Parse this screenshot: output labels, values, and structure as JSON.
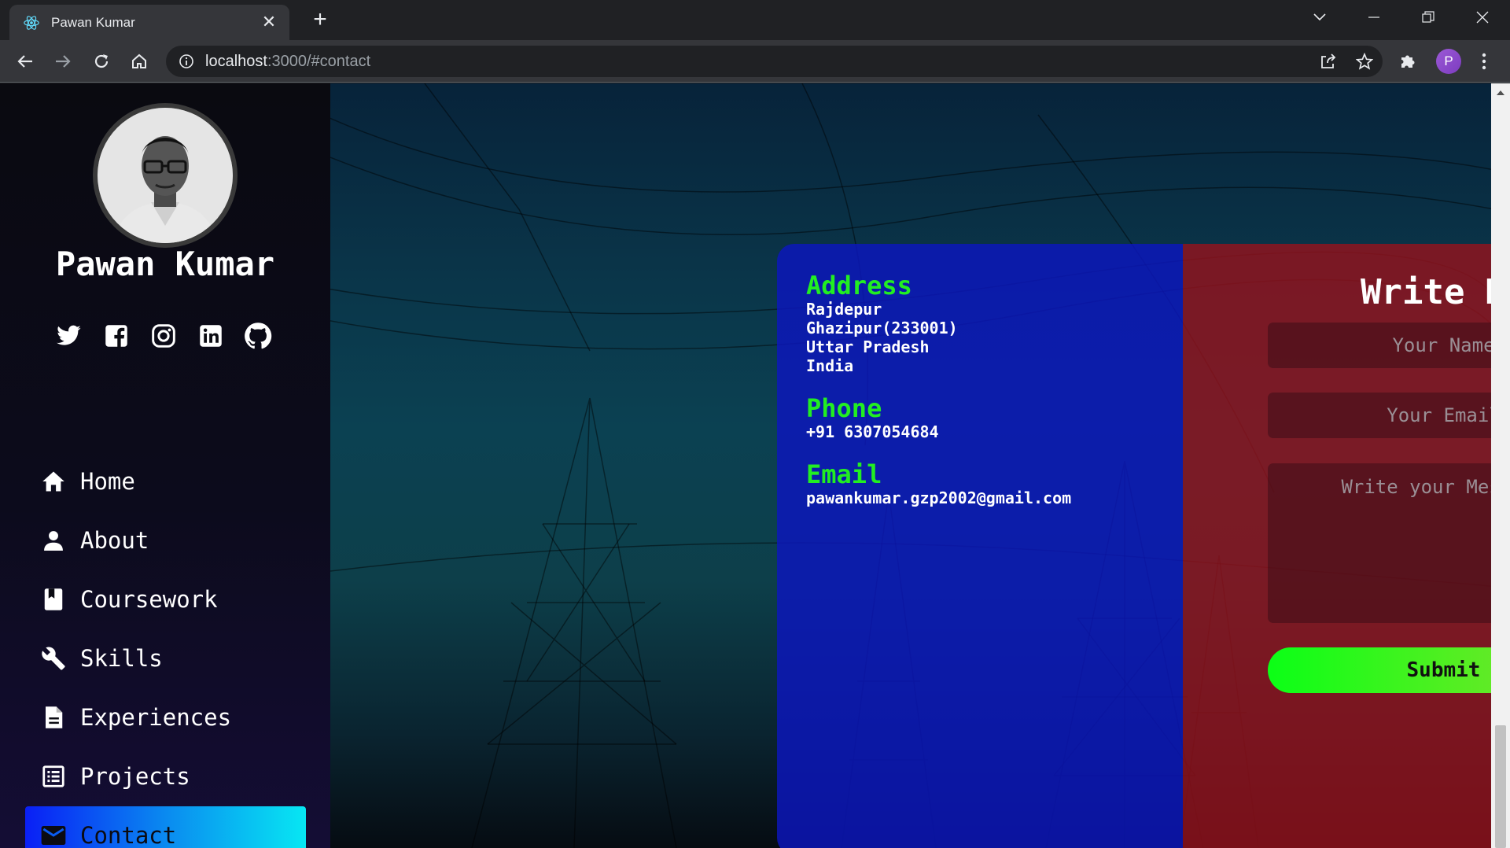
{
  "browser": {
    "tab_title": "Pawan Kumar",
    "url_host": "localhost",
    "url_path": ":3000/#contact",
    "profile_initial": "P"
  },
  "sidebar": {
    "name": "Pawan Kumar",
    "socials": [
      "twitter-icon",
      "facebook-icon",
      "instagram-icon",
      "linkedin-icon",
      "github-icon"
    ],
    "items": [
      {
        "label": "Home",
        "icon": "home-icon"
      },
      {
        "label": "About",
        "icon": "person-icon"
      },
      {
        "label": "Coursework",
        "icon": "book-icon"
      },
      {
        "label": "Skills",
        "icon": "wrench-icon"
      },
      {
        "label": "Experiences",
        "icon": "document-icon"
      },
      {
        "label": "Projects",
        "icon": "list-icon"
      },
      {
        "label": "Contact",
        "icon": "mail-icon",
        "active": true
      }
    ]
  },
  "contact": {
    "address_heading": "Address",
    "address_lines": [
      "Rajdepur",
      "Ghazipur(233001)",
      "Uttar Pradesh",
      "India"
    ],
    "phone_heading": "Phone",
    "phone": "+91 6307054684",
    "email_heading": "Email",
    "email": "pawankumar.gzp2002@gmail.com"
  },
  "form": {
    "title": "Write Me",
    "name_placeholder": "Your Name",
    "email_placeholder": "Your Email",
    "message_placeholder": "Write your Message",
    "submit_label": "Submit"
  },
  "colors": {
    "heading_green": "#22ee22",
    "active_gradient_start": "#0a1ff5",
    "active_gradient_end": "#07e7f3",
    "card_left": "#0c16be",
    "card_right": "#96121c",
    "submit_green": "#0bff16"
  }
}
